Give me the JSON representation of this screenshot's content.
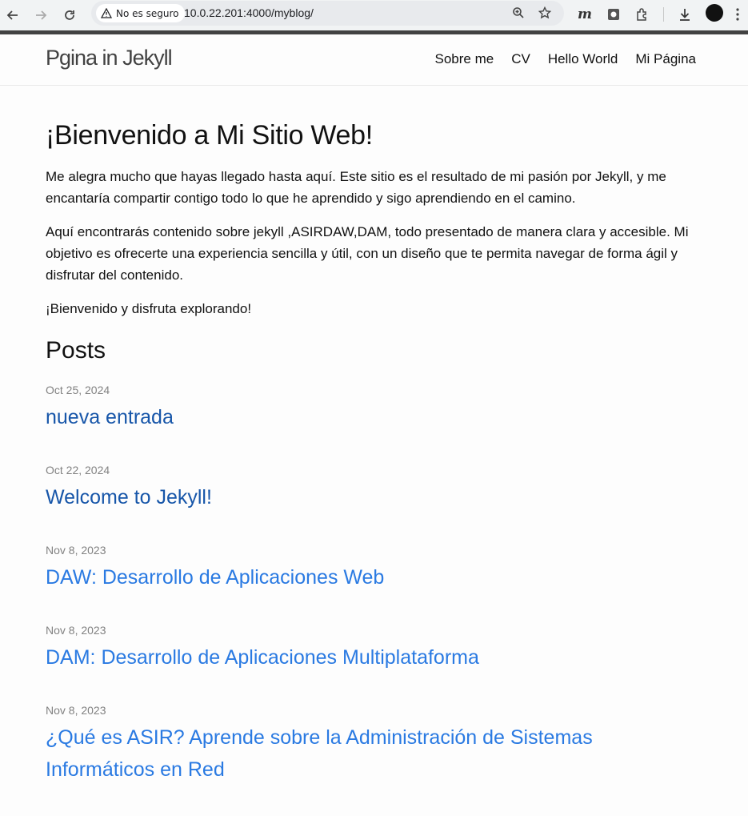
{
  "browser": {
    "security_label": "No es seguro",
    "url": "10.0.22.201:4000/myblog/"
  },
  "site": {
    "title": "Pgina in Jekyll",
    "nav": [
      "Sobre me",
      "CV",
      "Hello World",
      "Mi Página"
    ]
  },
  "main": {
    "heading": "¡Bienvenido a Mi Sitio Web!",
    "paragraphs": [
      "Me alegra mucho que hayas llegado hasta aquí. Este sitio es el resultado de mi pasión por Jekyll, y me encantaría compartir contigo todo lo que he aprendido y sigo aprendiendo en el camino.",
      "Aquí encontrarás contenido sobre jekyll ,ASIRDAW,DAM, todo presentado de manera clara y accesible. Mi objetivo es ofrecerte una experiencia sencilla y útil, con un diseño que te permita navegar de forma ágil y disfrutar del contenido.",
      "¡Bienvenido y disfruta explorando!"
    ],
    "posts_heading": "Posts",
    "posts": [
      {
        "date": "Oct 25, 2024",
        "title": "nueva entrada",
        "visited": true
      },
      {
        "date": "Oct 22, 2024",
        "title": "Welcome to Jekyll!",
        "visited": true
      },
      {
        "date": "Nov 8, 2023",
        "title": "DAW: Desarrollo de Aplicaciones Web",
        "visited": false
      },
      {
        "date": "Nov 8, 2023",
        "title": "DAM: Desarrollo de Aplicaciones Multiplataforma",
        "visited": false
      },
      {
        "date": "Nov 8, 2023",
        "title": "¿Qué es ASIR? Aprende sobre la Administración de Sistemas Informáticos en Red",
        "visited": false
      }
    ]
  },
  "colors": {
    "visited_link": "#1756a9",
    "link": "#2a7ae2",
    "date": "#828282"
  }
}
